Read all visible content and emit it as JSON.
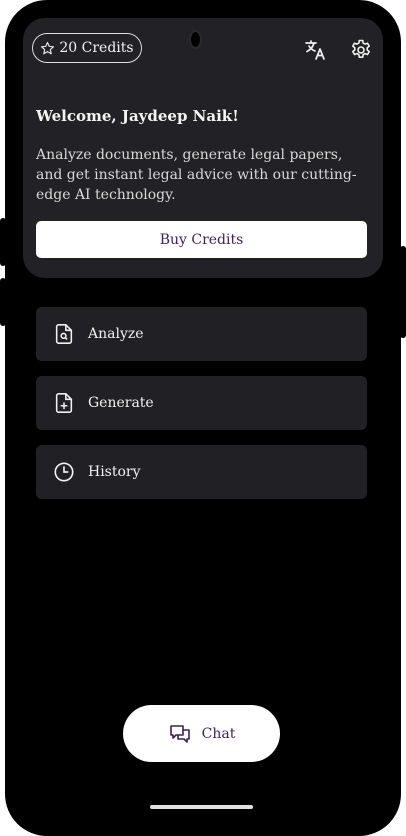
{
  "header": {
    "credits_label": "20 Credits",
    "welcome": "Welcome, Jaydeep Naik!",
    "description": "Analyze documents, generate legal papers, and get instant legal advice with our cutting-edge AI technology.",
    "buy_label": "Buy Credits"
  },
  "menu": [
    {
      "label": "Analyze",
      "icon": "document-search-icon"
    },
    {
      "label": "Generate",
      "icon": "document-add-icon"
    },
    {
      "label": "History",
      "icon": "clock-icon"
    }
  ],
  "chat": {
    "label": "Chat",
    "icon": "chat-bubbles-icon"
  },
  "colors": {
    "card": "#222226",
    "accent_text": "#3d1f5a",
    "background": "#000000"
  }
}
